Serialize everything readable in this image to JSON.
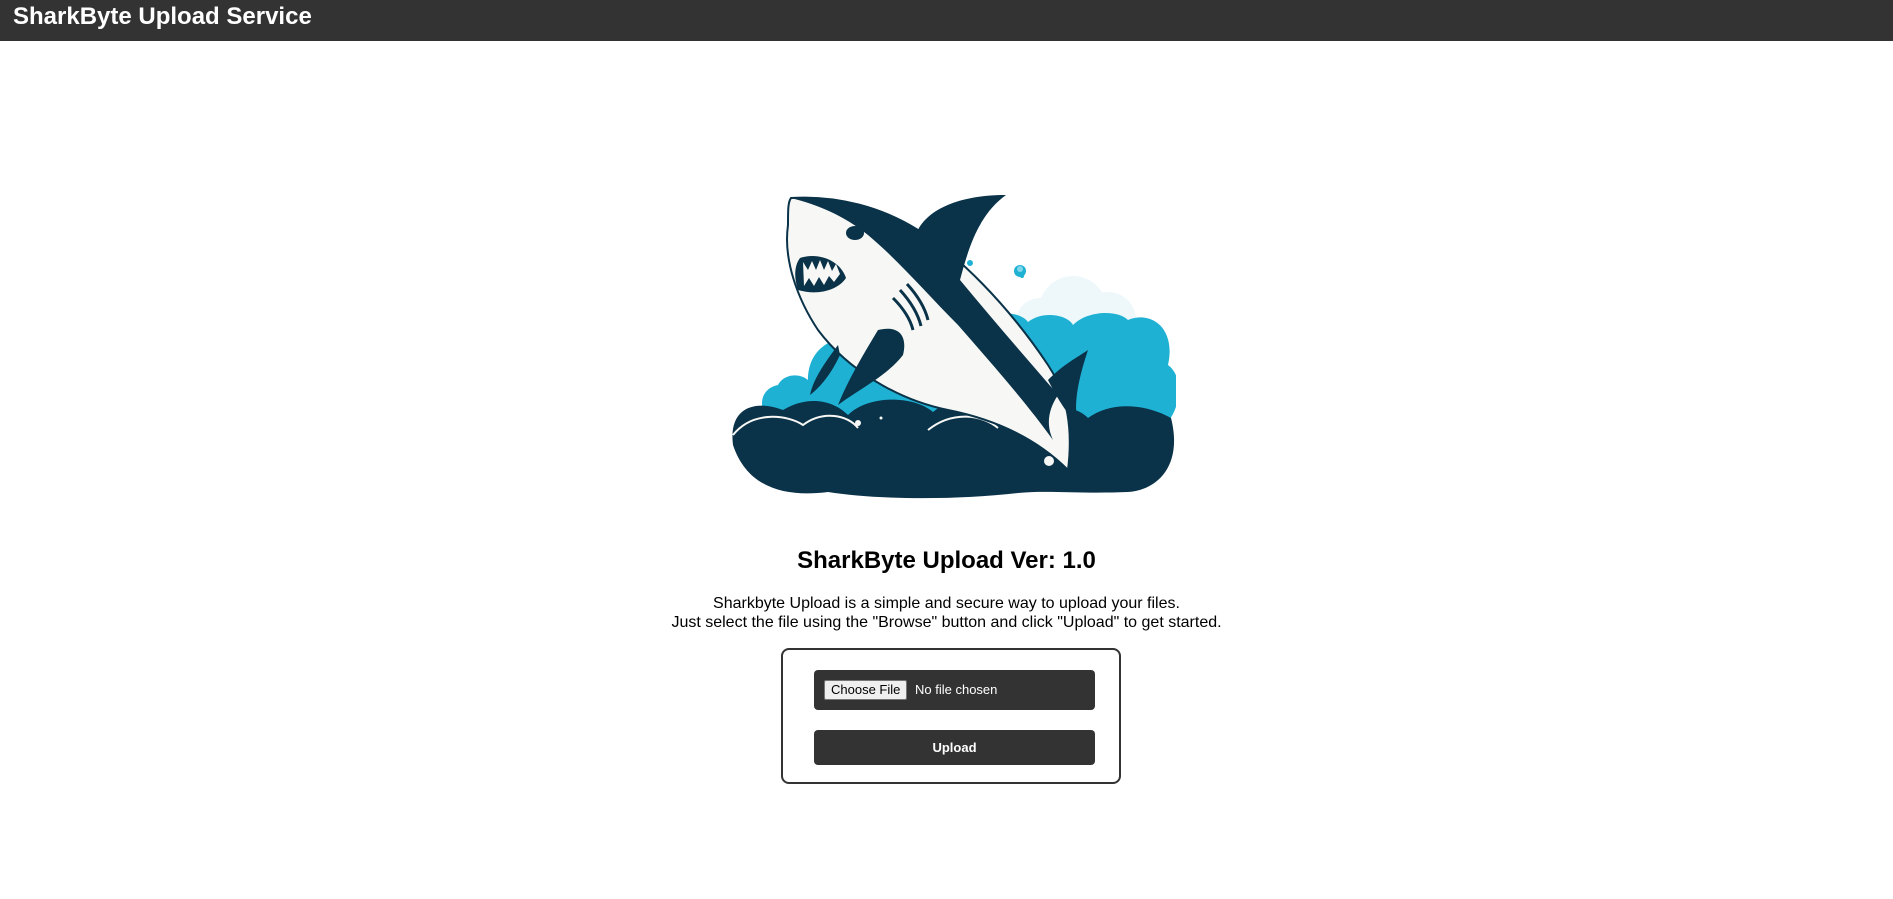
{
  "header": {
    "title": "SharkByte Upload Service"
  },
  "logo": {
    "icon": "shark-logo",
    "colors": {
      "navy": "#0a3248",
      "cyan": "#1fb1d4",
      "white": "#f7f8f5"
    }
  },
  "main": {
    "heading": "SharkByte Upload Ver: 1.0",
    "description_line1": "Sharkbyte Upload is a simple and secure way to upload your files.",
    "description_line2": "Just select the file using the \"Browse\" button and click \"Upload\" to get started."
  },
  "upload_form": {
    "choose_file_label": "Choose File",
    "file_status": "No file chosen",
    "upload_label": "Upload"
  },
  "theme": {
    "bar_color": "#333333"
  }
}
